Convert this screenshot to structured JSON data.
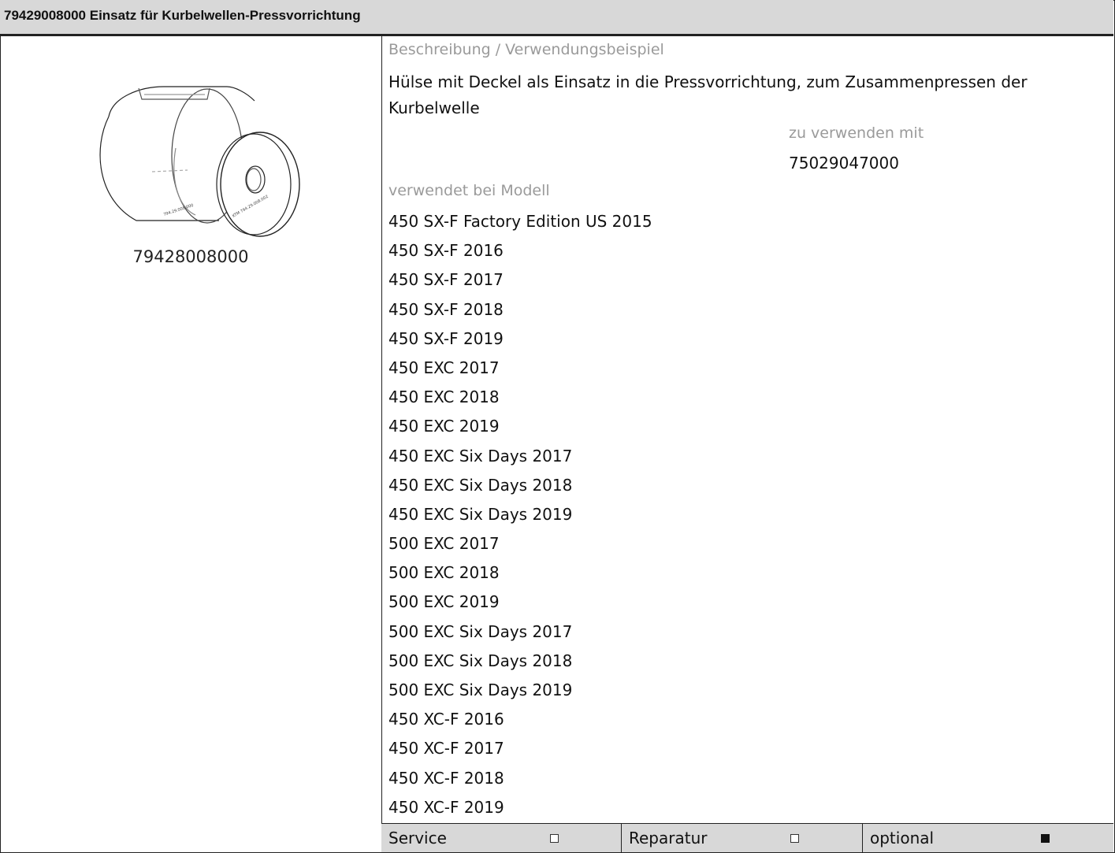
{
  "header": {
    "title": "79429008000 Einsatz für Kurbelwellen-Pressvorrichtung"
  },
  "tool": {
    "part_number": "79428008000",
    "image_icon": "sleeve-with-cover-illustration",
    "sleeve_engraving": "794.29.008.000",
    "cover_engraving": "KTM 794.29.008.002"
  },
  "description": {
    "label": "Beschreibung / Verwendungsbeispiel",
    "text": "Hülse mit Deckel als Einsatz in die Pressvorrichtung, zum Zusammenpressen der Kurbelwelle",
    "use_with_label": "zu verwenden mit",
    "use_with_value": "75029047000"
  },
  "models": {
    "label": "verwendet bei Modell",
    "items": [
      "450 SX-F Factory Edition US 2015",
      "450 SX-F 2016",
      "450 SX-F 2017",
      "450 SX-F 2018",
      "450 SX-F 2019",
      "450 EXC 2017",
      "450 EXC 2018",
      "450 EXC 2019",
      "450 EXC Six Days 2017",
      "450 EXC Six Days 2018",
      "450 EXC Six Days 2019",
      "500 EXC 2017",
      "500 EXC 2018",
      "500 EXC 2019",
      "500 EXC Six Days 2017",
      "500 EXC Six Days 2018",
      "500 EXC Six Days 2019",
      "450 XC-F 2016",
      "450 XC-F 2017",
      "450 XC-F 2018",
      "450 XC-F 2019"
    ]
  },
  "categories": [
    {
      "label": "Service",
      "checked": false
    },
    {
      "label": "Reparatur",
      "checked": false
    },
    {
      "label": "optional",
      "checked": true
    }
  ]
}
